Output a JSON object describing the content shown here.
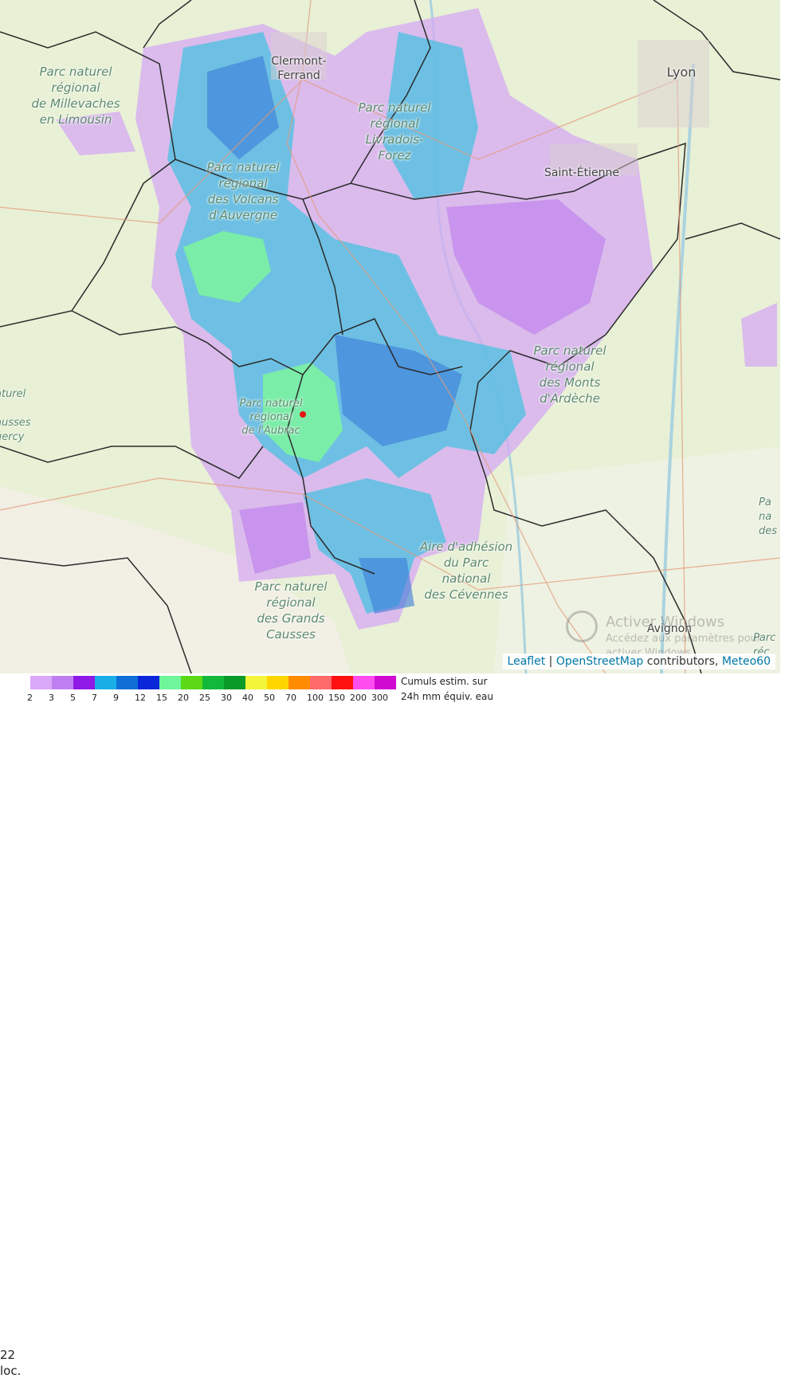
{
  "map": {
    "protected_areas": [
      {
        "id": "millevaches",
        "lines": [
          "Parc naturel",
          "régional",
          "de Millevaches",
          "en Limousin"
        ]
      },
      {
        "id": "livradois",
        "lines": [
          "Parc naturel",
          "régional",
          "Livradois-",
          "Forez"
        ]
      },
      {
        "id": "volcans",
        "lines": [
          "Parc naturel",
          "régional",
          "des Volcans",
          "d'Auvergne"
        ]
      },
      {
        "id": "ardeche",
        "lines": [
          "Parc naturel",
          "régional",
          "des Monts",
          "d'Ardèche"
        ]
      },
      {
        "id": "aubrac",
        "lines": [
          "Parc naturel",
          "régional",
          "de l'Aubrac"
        ]
      },
      {
        "id": "cevennes",
        "lines": [
          "Aire d'adhésion",
          "du Parc",
          "national",
          "des Cévennes"
        ]
      },
      {
        "id": "causses",
        "lines": [
          "Parc naturel",
          "régional",
          "des Grands",
          "Causses"
        ]
      },
      {
        "id": "quercy",
        "lines": [
          "aturel",
          "l",
          "ausses",
          "uercy"
        ]
      },
      {
        "id": "right-edge",
        "lines": [
          "Pa",
          "na",
          "des"
        ]
      },
      {
        "id": "right-edge-bottom",
        "lines": [
          "Parc",
          "réc"
        ]
      }
    ],
    "cities": [
      {
        "id": "clermont",
        "lines": [
          "Clermont-",
          "Ferrand"
        ]
      },
      {
        "id": "lyon",
        "lines": [
          "Lyon"
        ]
      },
      {
        "id": "saint-etienne",
        "lines": [
          "Saint-Étienne"
        ]
      },
      {
        "id": "avignon",
        "lines": [
          "Avignon"
        ]
      }
    ],
    "marker_color": "#e8150f"
  },
  "watermark": {
    "title": "Activer Windows",
    "subtitle": "Accédez aux paramètres pour",
    "subtitle2": "activer Windows"
  },
  "attribution": {
    "leaflet": "Leaflet",
    "separator": " | ",
    "osm": "OpenStreetMap",
    "contributors": " contributors, ",
    "meteo": "Meteo60"
  },
  "legend": {
    "left_line1": "22",
    "left_line2": "loc.",
    "ticks": [
      "2",
      "3",
      "5",
      "7",
      "9",
      "12",
      "15",
      "20",
      "25",
      "30",
      "40",
      "50",
      "70",
      "100",
      "150",
      "200",
      "300"
    ],
    "colors": [
      "#d9a8f7",
      "#c07ff0",
      "#8f1ae6",
      "#1aaee6",
      "#0f6fd6",
      "#0a26d9",
      "#6ff59a",
      "#5bd915",
      "#12b83a",
      "#0a9a27",
      "#f2f53a",
      "#ffd500",
      "#ff8c00",
      "#ff6a6a",
      "#ff1010",
      "#ff4df0",
      "#d10ad1"
    ],
    "note_line1": "Cumuls estim. sur",
    "note_line2": "24h mm équiv. eau"
  }
}
